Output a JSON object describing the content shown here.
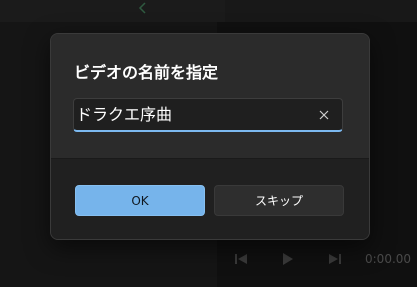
{
  "dialog": {
    "title": "ビデオの名前を指定",
    "name_value": "ドラクエ序曲",
    "clear_icon": "close-icon",
    "ok_label": "OK",
    "skip_label": "スキップ"
  },
  "player": {
    "time": "0:00.00",
    "icons": [
      "previous-icon",
      "play-icon",
      "next-icon"
    ]
  },
  "colors": {
    "accent": "#76b4eb",
    "dialog_bg": "#2b2b2b",
    "footer_bg": "#202020"
  }
}
